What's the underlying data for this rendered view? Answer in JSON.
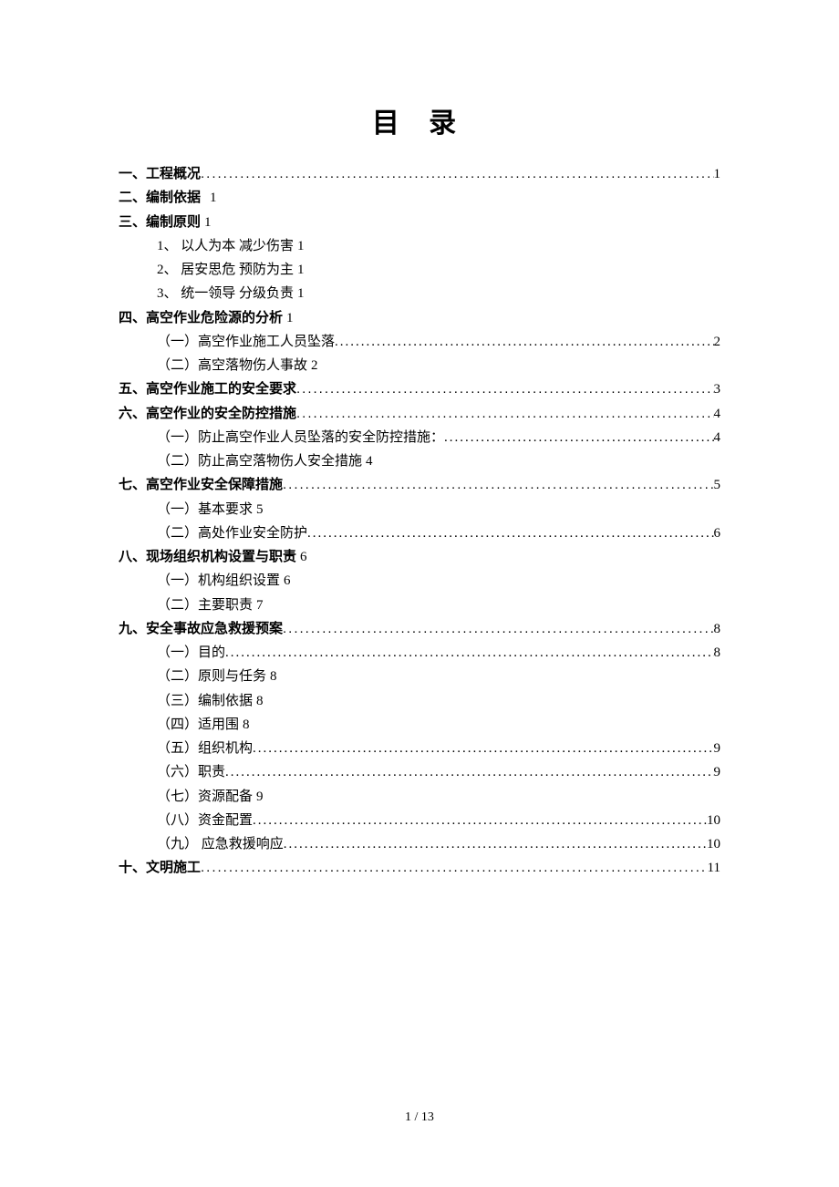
{
  "title": "目 录",
  "footer": "1 / 13",
  "entries": [
    {
      "level": 1,
      "label": "一、工程概况",
      "page": "1",
      "dotted": true
    },
    {
      "level": 1,
      "label": "二、编制依据",
      "page": "1",
      "dotted": false,
      "gap": true
    },
    {
      "level": 1,
      "label": "三、编制原则",
      "page": "1",
      "dotted": false
    },
    {
      "level": 2,
      "label": "1、 以人为本 减少伤害",
      "page": "1",
      "dotted": false
    },
    {
      "level": 2,
      "label": "2、 居安思危 预防为主",
      "page": "1",
      "dotted": false
    },
    {
      "level": 2,
      "label": "3、 统一领导 分级负责",
      "page": "1",
      "dotted": false
    },
    {
      "level": 1,
      "label": "四、高空作业危险源的分析",
      "page": "1",
      "dotted": false
    },
    {
      "level": 2,
      "label": "（一）高空作业施工人员坠落",
      "page": "2",
      "dotted": true
    },
    {
      "level": 2,
      "label": "（二）高空落物伤人事故",
      "page": "2",
      "dotted": false
    },
    {
      "level": 1,
      "label": "五、高空作业施工的安全要求",
      "page": "3",
      "dotted": true
    },
    {
      "level": 1,
      "label": "六、高空作业的安全防控措施",
      "page": "4",
      "dotted": true
    },
    {
      "level": 2,
      "label": "（一）防止高空作业人员坠落的安全防控措施：",
      "page": "4",
      "dotted": true
    },
    {
      "level": 2,
      "label": "（二）防止高空落物伤人安全措施",
      "page": "4",
      "dotted": false
    },
    {
      "level": 1,
      "label": "七、高空作业安全保障措施",
      "page": "5",
      "dotted": true
    },
    {
      "level": 2,
      "label": "（一）基本要求",
      "page": "5",
      "dotted": false
    },
    {
      "level": 2,
      "label": "（二）高处作业安全防护",
      "page": "6",
      "dotted": true
    },
    {
      "level": 1,
      "label": "八、现场组织机构设置与职责",
      "page": "6",
      "dotted": false
    },
    {
      "level": 2,
      "label": "（一）机构组织设置",
      "page": "6",
      "dotted": false
    },
    {
      "level": 2,
      "label": "（二）主要职责",
      "page": "7",
      "dotted": false
    },
    {
      "level": 1,
      "label": "九、安全事故应急救援预案",
      "page": "8",
      "dotted": true
    },
    {
      "level": 2,
      "label": "（一）目的",
      "page": "8",
      "dotted": true
    },
    {
      "level": 2,
      "label": "（二）原则与任务",
      "page": "8",
      "dotted": false
    },
    {
      "level": 2,
      "label": "（三）编制依据",
      "page": "8",
      "dotted": false
    },
    {
      "level": 2,
      "label": "（四）适用围",
      "page": "8",
      "dotted": false
    },
    {
      "level": 2,
      "label": "（五）组织机构",
      "page": "9",
      "dotted": true
    },
    {
      "level": 2,
      "label": "（六）职责",
      "page": "9",
      "dotted": true
    },
    {
      "level": 2,
      "label": "（七）资源配备",
      "page": "9",
      "dotted": false
    },
    {
      "level": 2,
      "label": "（八）资金配置",
      "page": "10",
      "dotted": true
    },
    {
      "level": 2,
      "label": "（九） 应急救援响应",
      "page": "10",
      "dotted": true
    },
    {
      "level": 1,
      "label": "十、文明施工",
      "page": "11",
      "dotted": true
    }
  ]
}
